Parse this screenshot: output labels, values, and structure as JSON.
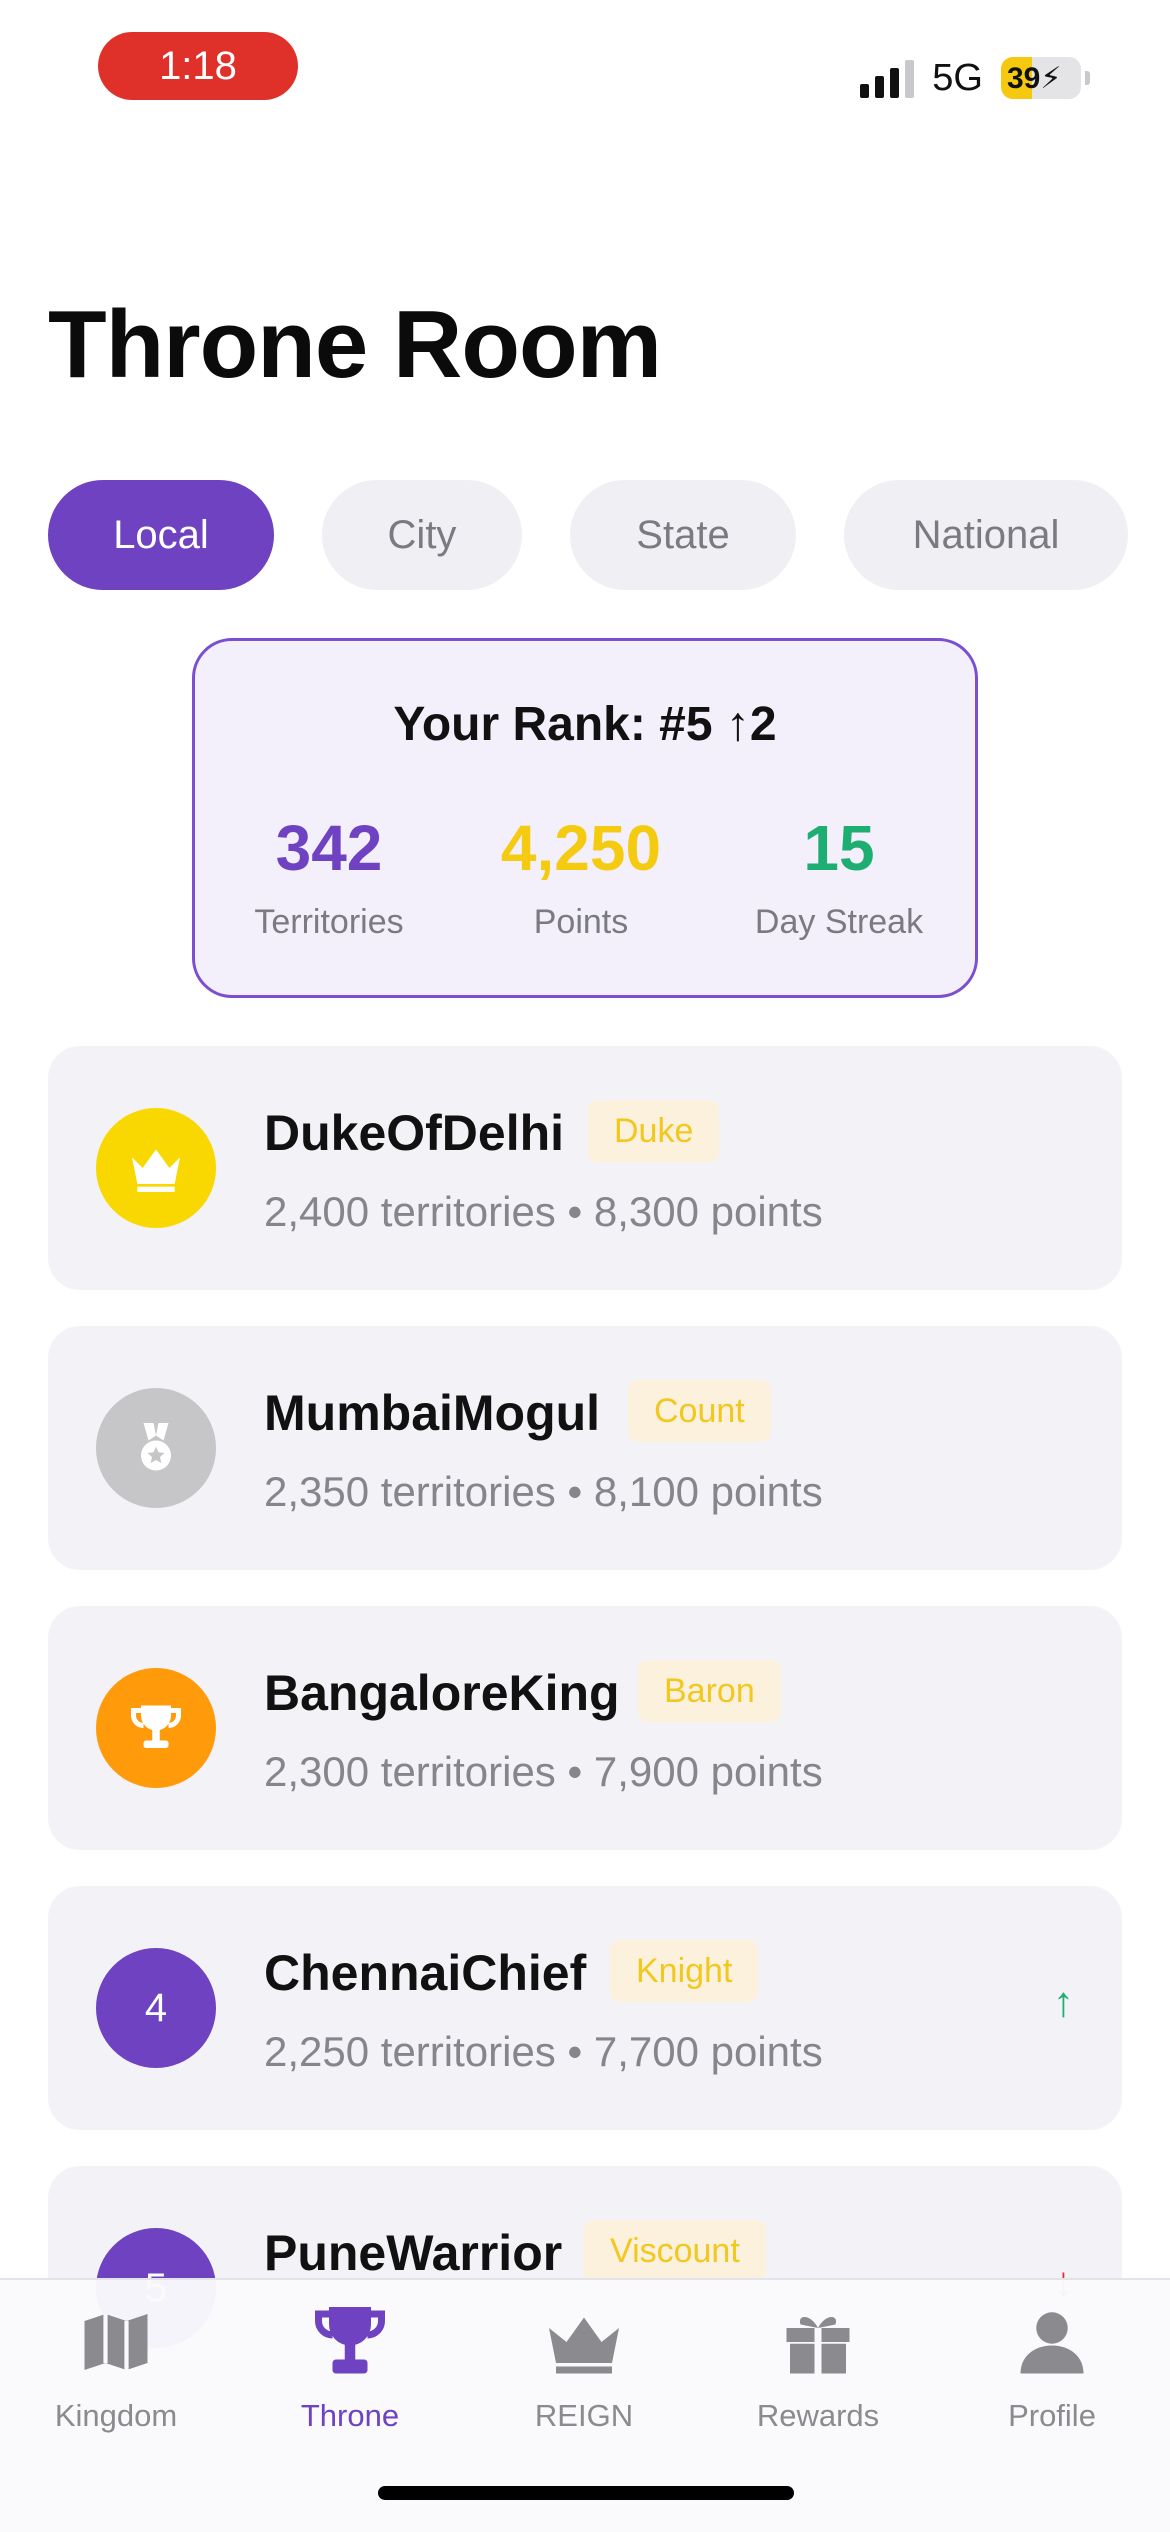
{
  "status_bar": {
    "time": "1:18",
    "network": "5G",
    "battery": "39",
    "battery_fraction": 0.39,
    "time_pill_color": "#e0302a",
    "battery_color": "#f5c90f"
  },
  "page_title": "Throne Room",
  "tabs": [
    {
      "label": "Local",
      "active": true
    },
    {
      "label": "City",
      "active": false
    },
    {
      "label": "State",
      "active": false
    },
    {
      "label": "National",
      "active": false
    }
  ],
  "rank_card": {
    "title": "Your Rank: #5 ↑2",
    "stats": [
      {
        "value": "342",
        "label": "Territories",
        "color": "#6e42c1"
      },
      {
        "value": "4,250",
        "label": "Points",
        "color": "#f5cb12"
      },
      {
        "value": "15",
        "label": "Day Streak",
        "color": "#1fae72"
      }
    ]
  },
  "leaderboard": [
    {
      "name": "DukeOfDelhi",
      "title": "Duke",
      "stats": "2,400 territories • 8,300 points",
      "badge_icon": "crown-icon",
      "badge_color": "#f8d800"
    },
    {
      "name": "MumbaiMogul",
      "title": "Count",
      "stats": "2,350 territories • 8,100 points",
      "badge_icon": "medal-icon",
      "badge_color": "#c6c6c8"
    },
    {
      "name": "BangaloreKing",
      "title": "Baron",
      "stats": "2,300 territories • 7,900 points",
      "badge_icon": "trophy-icon",
      "badge_color": "#ff9a0a"
    },
    {
      "name": "ChennaiChief",
      "title": "Knight",
      "rank": "4",
      "stats": "2,250 territories • 7,700 points",
      "trend": "↑",
      "trend_color": "#1fae72",
      "badge_color": "#6e42c1"
    },
    {
      "name": "PuneWarrior",
      "title": "Viscount",
      "rank": "5",
      "trend": "↓",
      "trend_color": "#e0302a",
      "badge_color": "#6e42c1"
    }
  ],
  "bottom_nav": [
    {
      "label": "Kingdom",
      "icon": "map-icon",
      "active": false
    },
    {
      "label": "Throne",
      "icon": "trophy-icon",
      "active": true
    },
    {
      "label": "REIGN",
      "icon": "crown-icon",
      "active": false
    },
    {
      "label": "Rewards",
      "icon": "gift-icon",
      "active": false
    },
    {
      "label": "Profile",
      "icon": "person-icon",
      "active": false
    }
  ]
}
